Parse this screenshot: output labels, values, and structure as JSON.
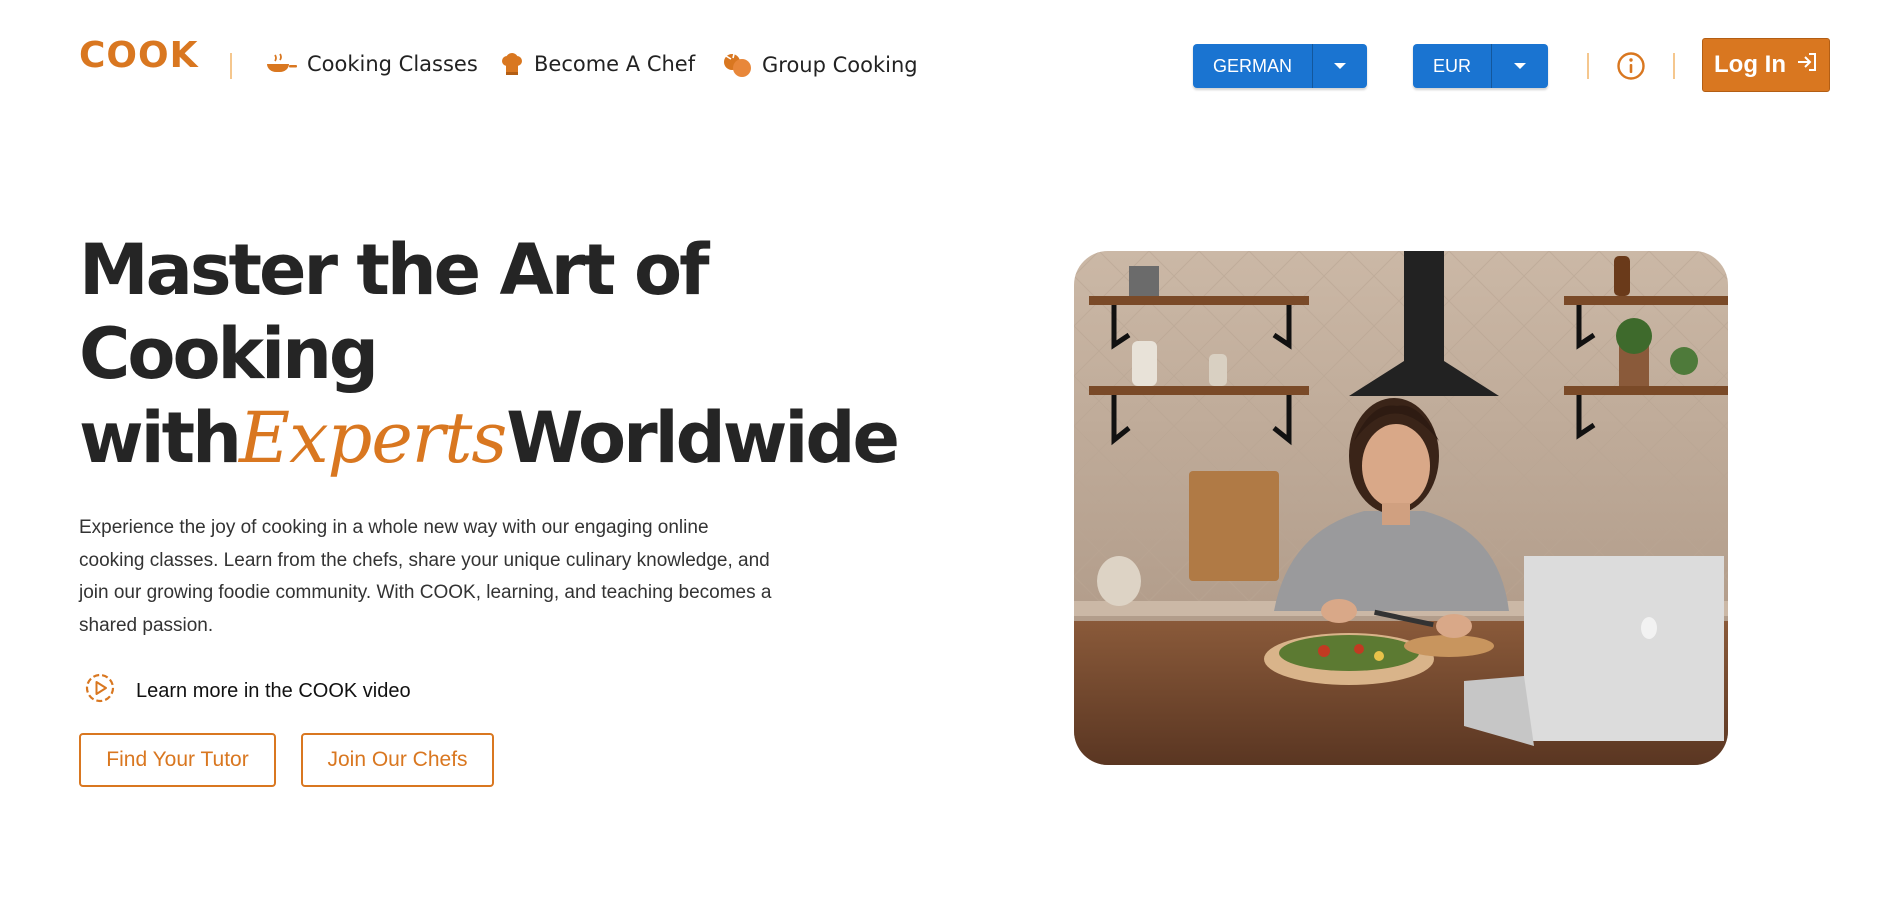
{
  "header": {
    "logo": "COOK",
    "nav": [
      {
        "label": "Cooking Classes",
        "icon": "pan-icon"
      },
      {
        "label": "Become A Chef",
        "icon": "chef-hat-icon"
      },
      {
        "label": "Group Cooking",
        "icon": "group-food-icon"
      }
    ],
    "language": {
      "value": "GERMAN",
      "icon": "caret-down-icon"
    },
    "currency": {
      "value": "EUR",
      "icon": "caret-down-icon"
    },
    "info_icon": "info-icon",
    "login_label": "Log In",
    "login_icon": "login-arrow-icon"
  },
  "hero": {
    "title_line1": "Master the Art of",
    "title_line2": "Cooking",
    "title_with": "with",
    "title_accent": "Experts",
    "title_end": "Worldwide",
    "description": "Experience the joy of cooking in a whole new way with our engaging online cooking classes. Learn from the chefs, share your unique culinary knowledge, and join our growing foodie community. With COOK, learning, and teaching becomes a shared passion.",
    "video_link": "Learn more in the COOK video",
    "video_icon": "play-circle-icon",
    "primary_button": "Find Your Tutor",
    "secondary_button": "Join Our Chefs",
    "image_subject": "woman-chopping-vegetables-kitchen-photo"
  },
  "colors": {
    "accent": "#d97720",
    "select_blue": "#1a74d1",
    "text_dark": "#252525"
  }
}
